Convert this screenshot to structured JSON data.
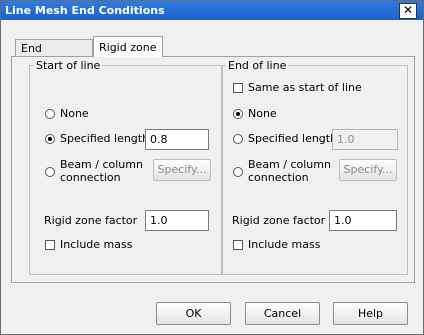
{
  "dialog": {
    "title": "Line Mesh End Conditions",
    "close_label": "✕"
  },
  "tabs": [
    {
      "label": "End releases",
      "active": false
    },
    {
      "label": "Rigid zone",
      "active": true
    }
  ],
  "start": {
    "legend": "Start of line",
    "none_label": "None",
    "specified_length_label": "Specified length",
    "specified_length_value": "0.8",
    "beam_label_line1": "Beam / column",
    "beam_label_line2": "connection",
    "specify_label": "Specify...",
    "selected": "specified_length",
    "rigid_zone_factor_label": "Rigid zone factor",
    "rigid_zone_factor_value": "1.0",
    "include_mass_label": "Include mass",
    "include_mass_checked": false
  },
  "end": {
    "legend": "End of line",
    "same_as_start_label": "Same as start of line",
    "same_as_start_checked": false,
    "none_label": "None",
    "specified_length_label": "Specified length",
    "specified_length_value": "1.0",
    "beam_label_line1": "Beam / column",
    "beam_label_line2": "connection",
    "specify_label": "Specify...",
    "selected": "none",
    "rigid_zone_factor_label": "Rigid zone factor",
    "rigid_zone_factor_value": "1.0",
    "include_mass_label": "Include mass",
    "include_mass_checked": false
  },
  "buttons": {
    "ok": "OK",
    "cancel": "Cancel",
    "help": "Help"
  }
}
